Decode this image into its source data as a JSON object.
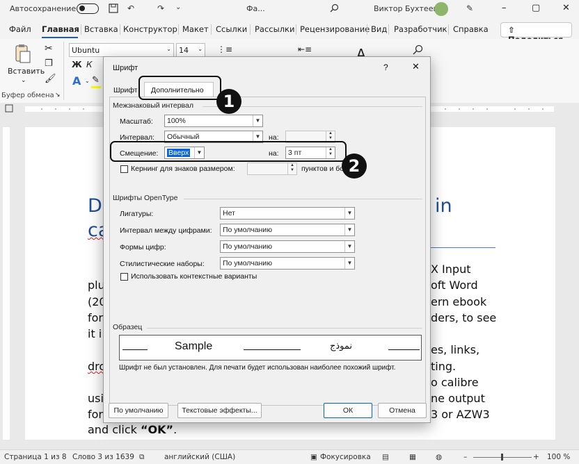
{
  "titlebar": {
    "autosave_label": "Автосохранение",
    "doc_name": "Фа...",
    "user_name": "Виктор Бухтеев",
    "icons": [
      "save-icon",
      "undo-icon",
      "redo-icon",
      "customize-icon",
      "search-icon",
      "minimize-icon",
      "maximize-icon",
      "close-icon"
    ]
  },
  "menubar": {
    "tabs": [
      "Файл",
      "Главная",
      "Вставка",
      "Конструктор",
      "Макет",
      "Ссылки",
      "Рассылки",
      "Рецензирование",
      "Вид",
      "Разработчик",
      "Справка"
    ],
    "active_tab": "Главная",
    "share_label": "Поделиться"
  },
  "ribbon": {
    "paste_label": "Вставить",
    "clipboard_group": "Буфер обмена",
    "font_name": "Ubuntu",
    "font_size": "14",
    "bold": "Ж",
    "italic": "К"
  },
  "document": {
    "heading_left_1": "D",
    "heading_right_1": "in",
    "heading_left_2": "ca",
    "lines_left": [
      "plu",
      "(20",
      "for",
      "it i",
      "dro",
      "usi",
      "for"
    ],
    "lines_right": [
      "X Input",
      "oft Word",
      "ern ebook",
      "ders, to see",
      "es, links,",
      "ting.",
      "o calibre",
      "ne output",
      "3 or AZW3"
    ],
    "final_line_prefix": "and click ",
    "final_line_bold": "“OK”",
    "final_line_suffix": "."
  },
  "statusbar": {
    "page": "Страница 1 из 8",
    "words": "Слово 3 из 1639",
    "language": "английский (США)",
    "focus": "Фокусировка",
    "zoom": "100 %"
  },
  "dialog": {
    "title": "Шрифт",
    "help": "?",
    "close": "✕",
    "tabs": [
      "Шрифт",
      "Дополнительно"
    ],
    "active_tab": "Дополнительно",
    "spacing_group": "Межзнаковый интервал",
    "scale_label": "Масштаб:",
    "scale_value": "100%",
    "interval_label": "Интервал:",
    "interval_value": "Обычный",
    "interval_by_label": "на:",
    "interval_by_value": "",
    "offset_label": "Смещение:",
    "offset_value": "Вверх",
    "offset_by_label": "на:",
    "offset_by_value": "3 пт",
    "kerning_label": "Кернинг для знаков размером:",
    "kerning_value": "",
    "kerning_suffix": "пунктов и бо...",
    "opentype_group": "Шрифты OpenType",
    "ligatures_label": "Лигатуры:",
    "ligatures_value": "Нет",
    "numspacing_label": "Интервал между цифрами:",
    "numspacing_value": "По умолчанию",
    "numforms_label": "Формы цифр:",
    "numforms_value": "По умолчанию",
    "stylistic_label": "Стилистические наборы:",
    "stylistic_value": "По умолчанию",
    "contextual_label": "Использовать контекстные варианты",
    "preview_group": "Образец",
    "preview_sample": "Sample",
    "preview_arabic": "نموذج",
    "preview_note": "Шрифт не был установлен. Для печати будет использован наиболее похожий шрифт.",
    "btn_default": "По умолчанию",
    "btn_effects": "Текстовые эффекты...",
    "btn_ok": "ОК",
    "btn_cancel": "Отмена"
  },
  "callouts": {
    "one": "1",
    "two": "2"
  }
}
